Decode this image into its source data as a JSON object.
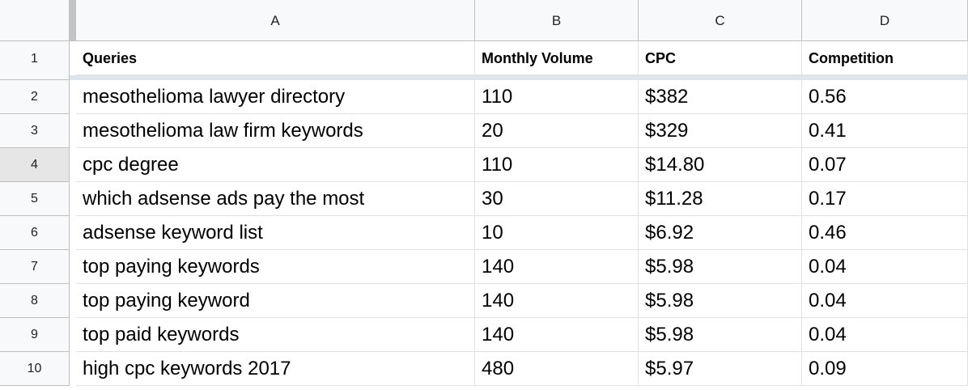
{
  "columns": [
    "A",
    "B",
    "C",
    "D"
  ],
  "row_numbers": [
    "1",
    "2",
    "3",
    "4",
    "5",
    "6",
    "7",
    "8",
    "9",
    "10"
  ],
  "header_row": [
    "Queries",
    "Monthly Volume",
    "CPC",
    "Competition"
  ],
  "rows": [
    [
      "mesothelioma lawyer directory",
      "110",
      "$382",
      "0.56"
    ],
    [
      "mesothelioma law firm keywords",
      "20",
      "$329",
      "0.41"
    ],
    [
      "cpc degree",
      "110",
      "$14.80",
      "0.07"
    ],
    [
      "which adsense ads pay the most",
      "30",
      "$11.28",
      "0.17"
    ],
    [
      "adsense keyword list",
      "10",
      "$6.92",
      "0.46"
    ],
    [
      "top paying keywords",
      "140",
      "$5.98",
      "0.04"
    ],
    [
      "top paying keyword",
      "140",
      "$5.98",
      "0.04"
    ],
    [
      "top paid keywords",
      "140",
      "$5.98",
      "0.04"
    ],
    [
      "high cpc keywords 2017",
      "480",
      "$5.97",
      "0.09"
    ]
  ],
  "selected_row": "4"
}
